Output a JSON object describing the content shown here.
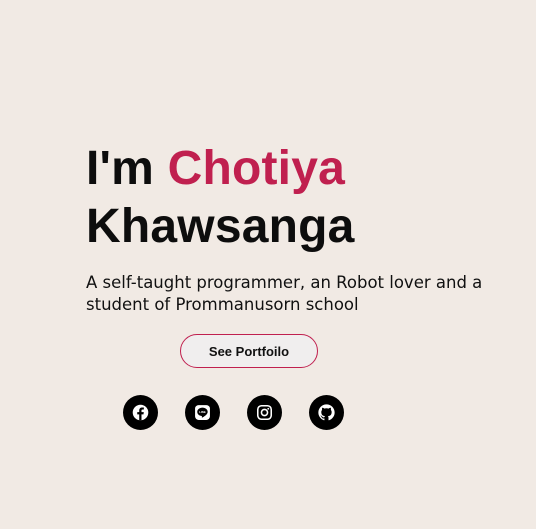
{
  "hero": {
    "greeting": "I'm ",
    "first_name": "Chotiya",
    "last_name": "Khawsanga",
    "tagline": "A self-taught programmer, an Robot lover and a student of Prommanusorn school",
    "accent_color": "#c0204f"
  },
  "cta": {
    "label": "See Portfoilo"
  },
  "socials": [
    {
      "icon": "facebook-icon"
    },
    {
      "icon": "line-icon"
    },
    {
      "icon": "instagram-icon"
    },
    {
      "icon": "github-icon"
    }
  ],
  "colors": {
    "background": "#f1eae4",
    "text": "#0d0d0d",
    "icon_bg": "#000000"
  }
}
